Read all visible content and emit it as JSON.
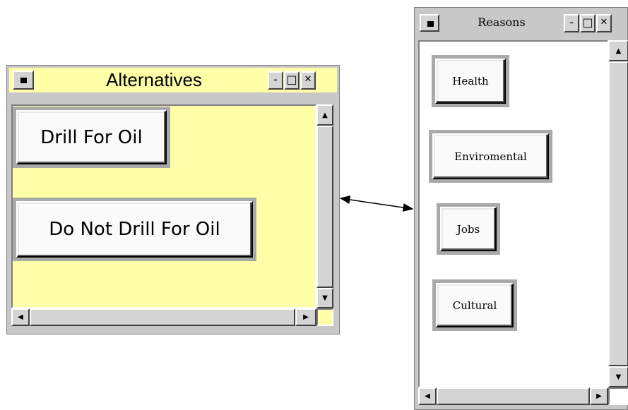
{
  "alternatives_window": {
    "title": "Alternatives",
    "controls": {
      "minimize": "-",
      "maximize": "□",
      "close": "✕"
    },
    "items": [
      "Drill For Oil",
      "Do Not Drill For Oil"
    ],
    "background": "#ffffa8"
  },
  "reasons_window": {
    "title": "Reasons",
    "controls": {
      "minimize": "-",
      "maximize": "□",
      "close": "✕"
    },
    "items": [
      "Health",
      "Enviromental",
      "Jobs",
      "Cultural"
    ],
    "background": "#ffffff"
  },
  "scroll_arrows": {
    "up": "▲",
    "down": "▼",
    "left": "◀",
    "right": "▶"
  },
  "connector": {
    "type": "double-headed-arrow",
    "from": "Alternatives",
    "to": "Reasons"
  }
}
